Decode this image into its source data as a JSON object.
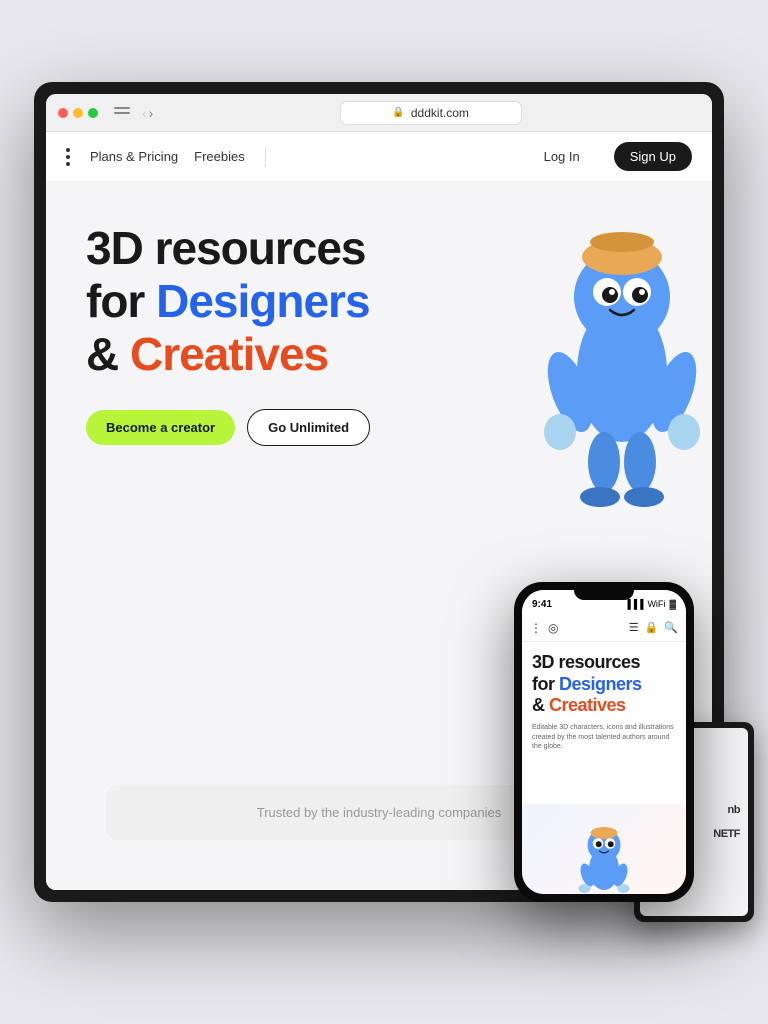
{
  "browser": {
    "address": "dddkit.com",
    "lock_icon": "🔒"
  },
  "site_nav": {
    "menu_dots": "⋮",
    "plans_pricing": "Plans & Pricing",
    "freebies": "Freebies",
    "login": "Log In",
    "signup": "Sign Up"
  },
  "hero": {
    "headline_line1": "3D resources",
    "headline_line2": "for ",
    "headline_blue": "Designers",
    "headline_line3": "& ",
    "headline_orange": "Creatives",
    "btn_creator": "Become a creator",
    "btn_unlimited": "Go Unlimited"
  },
  "trusted": {
    "text": "Trusted by the industry-leading companies"
  },
  "phone": {
    "time": "9:41",
    "headline_line1": "3D resources",
    "headline_line2": "for ",
    "headline_blue": "Designers",
    "headline_line3": "& ",
    "headline_orange": "Creatives",
    "sub_text": "Editable 3D characters, icons and illustrations created by the most talented authors around the globe."
  },
  "tablet": {
    "logo1": "nb",
    "logo2": "NETF"
  },
  "colors": {
    "blue": "#2563eb",
    "orange": "#e84c1e",
    "creator_btn": "#b8f53a",
    "dark": "#1a1a1a"
  }
}
